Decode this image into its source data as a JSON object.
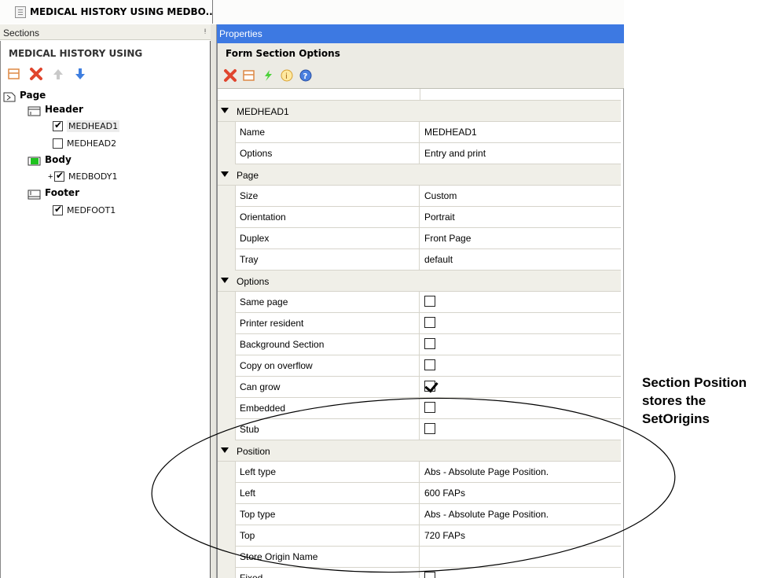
{
  "document_tab": {
    "title": "MEDICAL HISTORY USING MEDBO..."
  },
  "sections": {
    "header_label": "Sections",
    "pin_glyph": "ᵖ",
    "panel_title": "MEDICAL HISTORY USING",
    "toolbar_icons": [
      "add-section-icon",
      "delete-icon",
      "move-up-icon",
      "move-down-icon"
    ],
    "tree": {
      "page": "Page",
      "header": "Header",
      "header_items": [
        {
          "label": "MEDHEAD1",
          "checked": true
        },
        {
          "label": "MEDHEAD2",
          "checked": false
        }
      ],
      "body": "Body",
      "body_items": [
        {
          "label": "MEDBODY1",
          "checked": true,
          "expand": "+"
        }
      ],
      "footer": "Footer",
      "footer_items": [
        {
          "label": "MEDFOOT1",
          "checked": true
        }
      ]
    }
  },
  "properties": {
    "header_label": "Properties",
    "panel_title": "Form Section Options",
    "toolbar_icons": [
      "delete-icon",
      "add-section-icon",
      "lightning-icon",
      "info-icon",
      "help-icon"
    ],
    "rows": [
      {
        "kind": "cat",
        "name": "MEDHEAD1"
      },
      {
        "kind": "prop",
        "name": "Name",
        "value": "MEDHEAD1"
      },
      {
        "kind": "prop",
        "name": "Options",
        "value": "Entry and print"
      },
      {
        "kind": "cat",
        "name": "Page"
      },
      {
        "kind": "prop",
        "name": "Size",
        "value": "Custom"
      },
      {
        "kind": "prop",
        "name": "Orientation",
        "value": "Portrait"
      },
      {
        "kind": "prop",
        "name": "Duplex",
        "value": "Front Page"
      },
      {
        "kind": "prop",
        "name": "Tray",
        "value": "default"
      },
      {
        "kind": "cat",
        "name": "Options"
      },
      {
        "kind": "check",
        "name": "Same page",
        "checked": false
      },
      {
        "kind": "check",
        "name": "Printer resident",
        "checked": false
      },
      {
        "kind": "check",
        "name": "Background Section",
        "checked": false
      },
      {
        "kind": "check",
        "name": "Copy on overflow",
        "checked": false
      },
      {
        "kind": "check",
        "name": "Can grow",
        "checked": true
      },
      {
        "kind": "check",
        "name": "Embedded",
        "checked": false
      },
      {
        "kind": "check",
        "name": "Stub",
        "checked": false
      },
      {
        "kind": "cat",
        "name": "Position"
      },
      {
        "kind": "prop",
        "name": "Left type",
        "value": "Abs - Absolute Page Position."
      },
      {
        "kind": "prop",
        "name": "Left",
        "value": "600 FAPs"
      },
      {
        "kind": "prop",
        "name": "Top type",
        "value": "Abs - Absolute Page Position."
      },
      {
        "kind": "prop",
        "name": "Top",
        "value": "720 FAPs"
      },
      {
        "kind": "prop",
        "name": "Store Origin Name",
        "value": ""
      },
      {
        "kind": "check",
        "name": "Fixed",
        "checked": false
      }
    ]
  },
  "annotation": {
    "lines": [
      "Section Position",
      "stores the",
      "SetOrigins"
    ]
  },
  "colors": {
    "properties_header": "#3d79e2",
    "panel_bg": "#ecebe4",
    "category_bg": "#f0efe8"
  }
}
